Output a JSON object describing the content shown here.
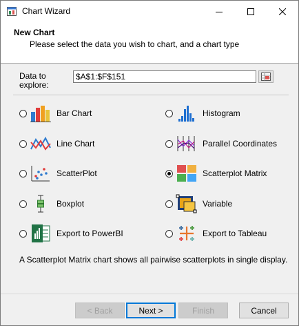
{
  "window": {
    "title": "Chart Wizard",
    "controls": {
      "minimize_icon": "minimize-icon",
      "maximize_icon": "maximize-icon",
      "close_icon": "close-icon"
    }
  },
  "header": {
    "title": "New Chart",
    "subtitle": "Please select the data you wish to chart, and a chart type"
  },
  "data_source": {
    "label": "Data to explore:",
    "value": "$A$1:$F$151"
  },
  "chart_types": [
    {
      "label": "Bar Chart",
      "icon": "bar-chart-icon",
      "selected": false
    },
    {
      "label": "Histogram",
      "icon": "histogram-icon",
      "selected": false
    },
    {
      "label": "Line Chart",
      "icon": "line-chart-icon",
      "selected": false
    },
    {
      "label": "Parallel Coordinates",
      "icon": "parallel-coordinates-icon",
      "selected": false
    },
    {
      "label": "ScatterPlot",
      "icon": "scatterplot-icon",
      "selected": false
    },
    {
      "label": "Scatterplot Matrix",
      "icon": "scatterplot-matrix-icon",
      "selected": true
    },
    {
      "label": "Boxplot",
      "icon": "boxplot-icon",
      "selected": false
    },
    {
      "label": "Variable",
      "icon": "variable-icon",
      "selected": false
    },
    {
      "label": "Export to PowerBI",
      "icon": "powerbi-icon",
      "selected": false
    },
    {
      "label": "Export to Tableau",
      "icon": "tableau-icon",
      "selected": false
    }
  ],
  "description": "A Scatterplot Matrix chart shows all pairwise scatterplots in  single display.",
  "buttons": {
    "back": "< Back",
    "next": "Next >",
    "finish": "Finish",
    "cancel": "Cancel"
  },
  "colors": {
    "accent": "#0078d7"
  }
}
